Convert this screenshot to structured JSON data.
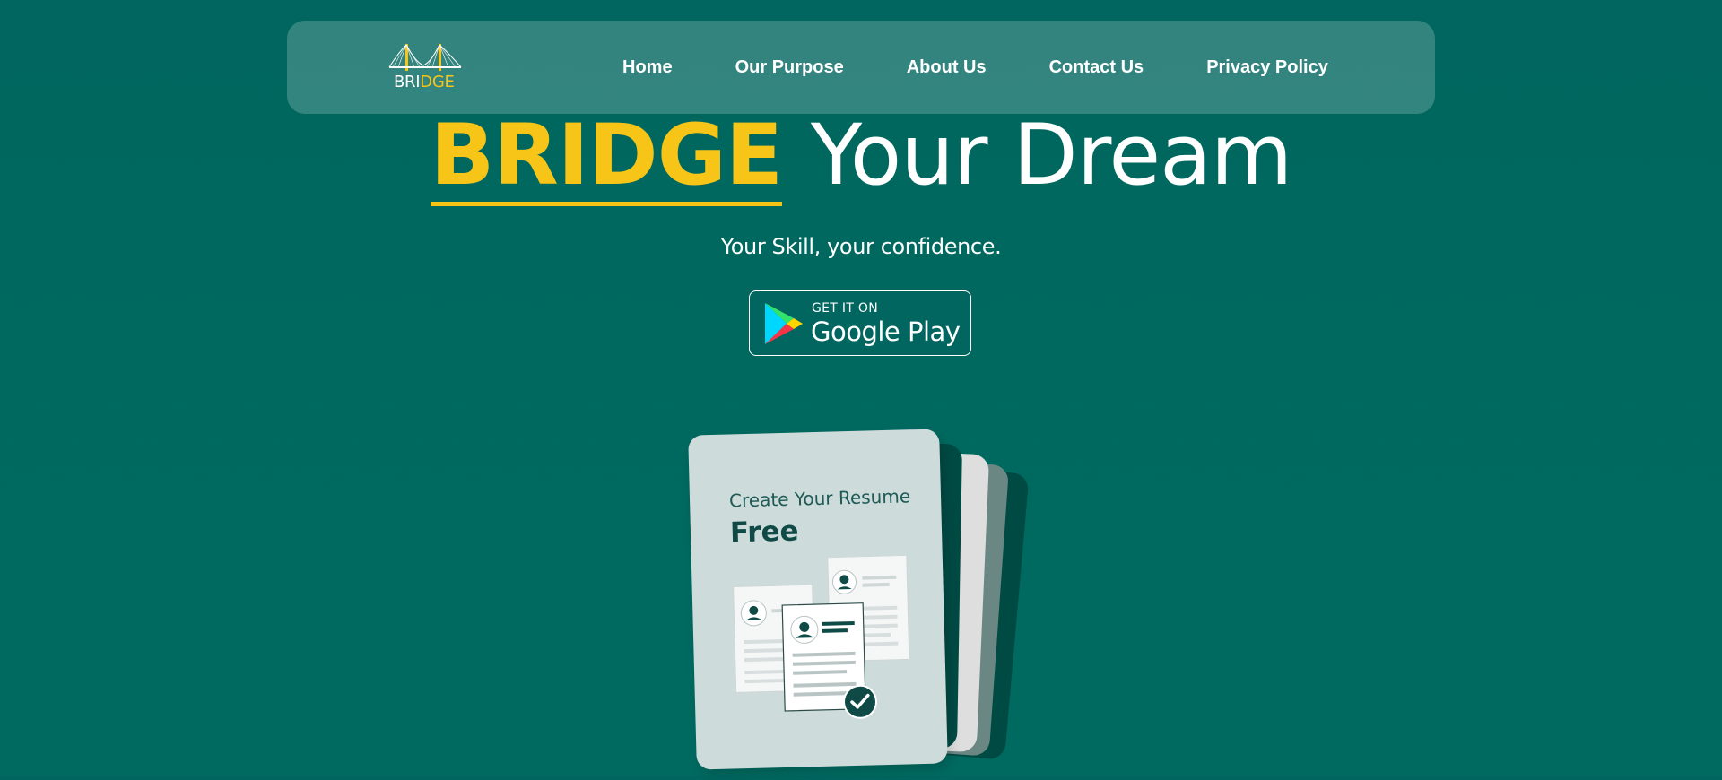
{
  "brand": {
    "logo_prefix": "BRI",
    "logo_suffix": "DGE",
    "logo_icon": "bridge-icon"
  },
  "nav": {
    "items": [
      {
        "label": "Home"
      },
      {
        "label": "Our Purpose"
      },
      {
        "label": "About Us"
      },
      {
        "label": "Contact Us"
      },
      {
        "label": "Privacy Policy"
      }
    ]
  },
  "hero": {
    "title_highlight": "BRIDGE",
    "title_rest": "Your Dream",
    "subtitle": "Your Skill, your confidence."
  },
  "play_badge": {
    "small_text": "GET IT ON",
    "big_text": "Google Play",
    "icon": "google-play-icon"
  },
  "card": {
    "heading": "Create Your Resume",
    "subheading": "Free",
    "illustration": "resume-documents-icon"
  },
  "colors": {
    "background": "#00665f",
    "accent_yellow": "#f7c518",
    "card_front": "#cddbda",
    "card_dark": "#004a44",
    "card_white": "#dedede",
    "card_grey": "#6b8784",
    "text": "#ffffff"
  }
}
